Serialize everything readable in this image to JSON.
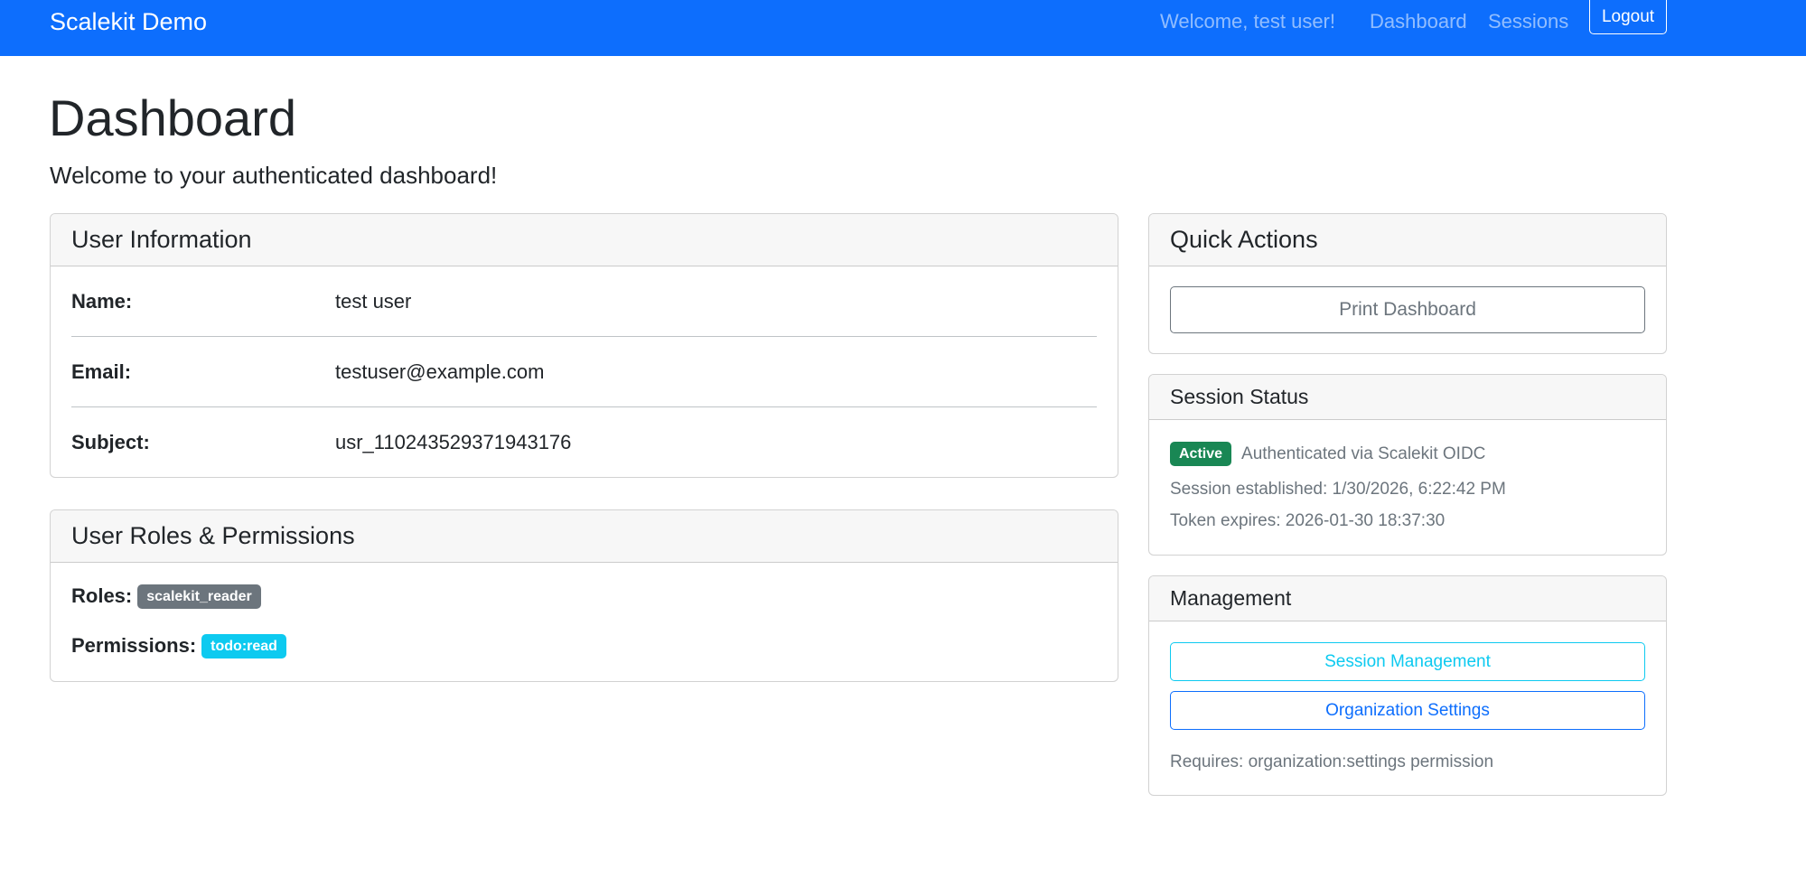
{
  "navbar": {
    "brand": "Scalekit Demo",
    "welcome": "Welcome, test user!",
    "links": {
      "dashboard": "Dashboard",
      "sessions": "Sessions"
    },
    "logout": "Logout"
  },
  "page": {
    "title": "Dashboard",
    "subtitle": "Welcome to your authenticated dashboard!"
  },
  "user_info": {
    "header": "User Information",
    "rows": [
      {
        "label": "Name:",
        "value": "test user"
      },
      {
        "label": "Email:",
        "value": "testuser@example.com"
      },
      {
        "label": "Subject:",
        "value": "usr_110243529371943176"
      }
    ]
  },
  "roles": {
    "header": "User Roles & Permissions",
    "roles_label": "Roles:",
    "roles": [
      "scalekit_reader"
    ],
    "permissions_label": "Permissions:",
    "permissions": [
      "todo:read"
    ]
  },
  "quick_actions": {
    "header": "Quick Actions",
    "print_button": "Print Dashboard"
  },
  "session_status": {
    "header": "Session Status",
    "badge": "Active",
    "auth_text": "Authenticated via Scalekit OIDC",
    "established": "Session established: 1/30/2026, 6:22:42 PM",
    "expires": "Token expires: 2026-01-30 18:37:30"
  },
  "management": {
    "header": "Management",
    "session_button": "Session Management",
    "org_button": "Organization Settings",
    "note": "Requires: organization:settings permission"
  },
  "colors": {
    "primary": "#0d6efd",
    "info": "#0dcaf0",
    "secondary": "#6c757d",
    "success": "#198754"
  }
}
